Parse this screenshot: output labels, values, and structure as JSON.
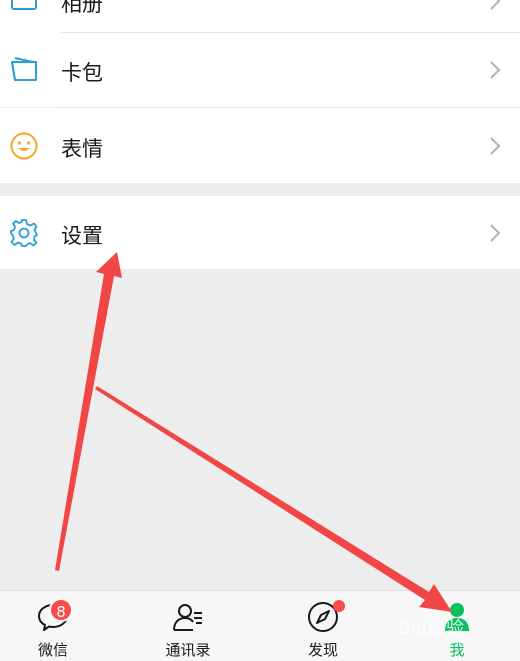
{
  "menu": {
    "album": {
      "label": "相册",
      "icon": "album-icon"
    },
    "cards": {
      "label": "卡包",
      "icon": "wallet-icon"
    },
    "stickers": {
      "label": "表情",
      "icon": "smiley-icon"
    },
    "settings": {
      "label": "设置",
      "icon": "gear-icon"
    }
  },
  "tabbar": {
    "tabs": [
      {
        "label": "微信",
        "icon": "chat-bubble-icon",
        "badge": "8"
      },
      {
        "label": "通讯录",
        "icon": "contacts-icon"
      },
      {
        "label": "发现",
        "icon": "compass-icon",
        "dot": true
      },
      {
        "label": "我",
        "icon": "me-person-icon",
        "active": true
      }
    ]
  },
  "watermark": "Bai经验",
  "colors": {
    "accent_green": "#07c160",
    "badge_red": "#f74c4c",
    "icon_blue": "#2b9ed8",
    "icon_orange": "#f5a623",
    "arrow_red": "#f24545"
  }
}
